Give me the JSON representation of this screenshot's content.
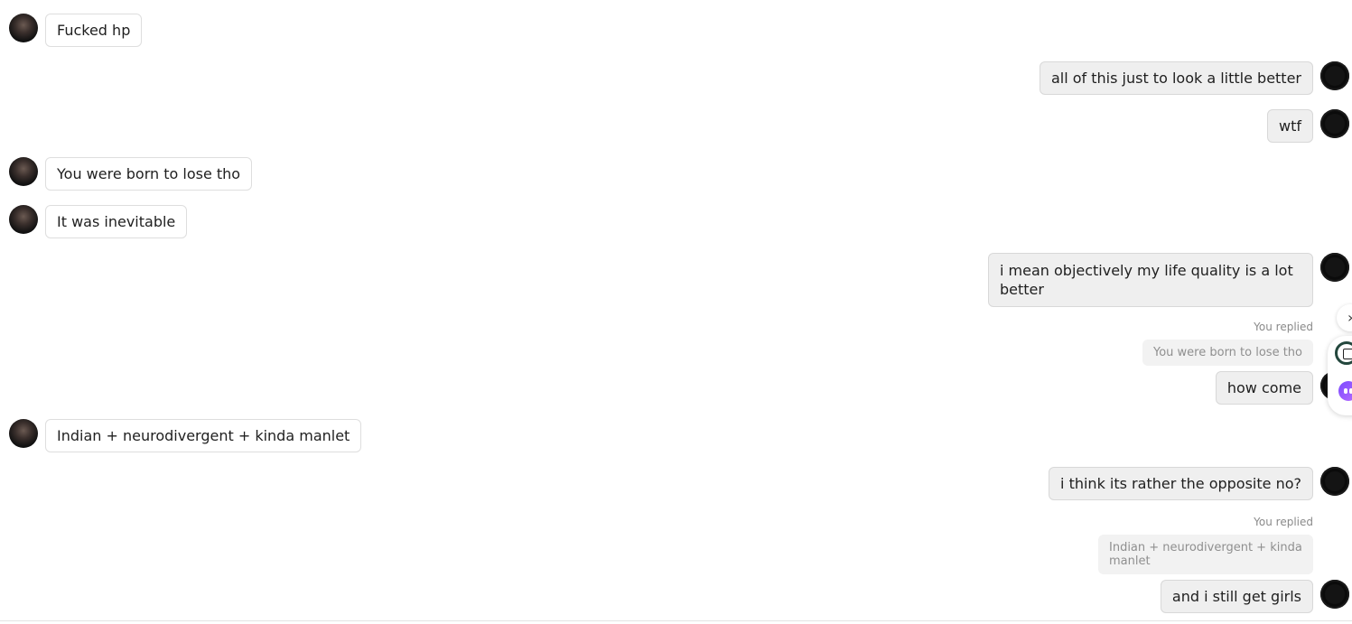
{
  "messages": [
    {
      "sender": "them",
      "text": "Fucked hp"
    },
    {
      "sender": "me",
      "text": "all of this just to look a little better"
    },
    {
      "sender": "me",
      "text": "wtf"
    },
    {
      "sender": "them",
      "text": "You were born to lose tho"
    },
    {
      "sender": "them",
      "text": "It was inevitable"
    },
    {
      "sender": "me",
      "text": "i mean objectively my life quality is a lot better"
    },
    {
      "sender": "me",
      "text": "how come",
      "reply_label": "You replied",
      "quoted_text": "You were born to lose tho"
    },
    {
      "sender": "them",
      "text": "Indian + neurodivergent + kinda manlet"
    },
    {
      "sender": "me",
      "text": "i think its rather the opposite no?"
    },
    {
      "sender": "me",
      "text": "and i still get girls",
      "reply_label": "You replied",
      "quoted_text": "Indian + neurodivergent + kinda manlet"
    }
  ],
  "side_controls": {
    "chevron_glyph": "›",
    "icons": [
      "chevron-right-icon",
      "calculator-icon",
      "assistant-bot-icon"
    ]
  }
}
